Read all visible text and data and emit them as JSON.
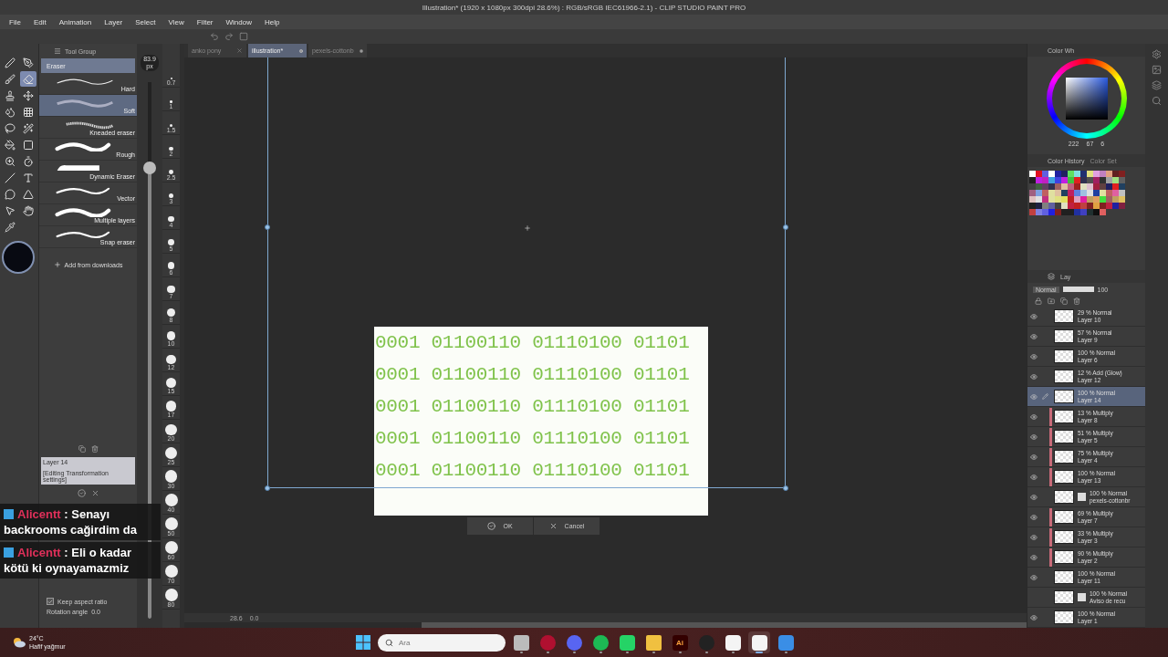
{
  "window": {
    "title": "Illustration* (1920 x 1080px 300dpi 28.6%) : RGB/sRGB IEC61966-2.1) - CLIP STUDIO PAINT PRO"
  },
  "menu": [
    "File",
    "Edit",
    "Animation",
    "Layer",
    "Select",
    "View",
    "Filter",
    "Window",
    "Help"
  ],
  "tools": [
    {
      "kind": "pen",
      "selected": false
    },
    {
      "kind": "pen-tool",
      "selected": false
    },
    {
      "kind": "brush",
      "selected": false
    },
    {
      "kind": "eraser",
      "selected": true
    },
    {
      "kind": "stamp",
      "selected": false
    },
    {
      "kind": "move",
      "selected": false
    },
    {
      "kind": "blend",
      "selected": false
    },
    {
      "kind": "grid",
      "selected": false
    },
    {
      "kind": "lasso",
      "selected": false
    },
    {
      "kind": "wand",
      "selected": false
    },
    {
      "kind": "bucket",
      "selected": false
    },
    {
      "kind": "gradient",
      "selected": false
    },
    {
      "kind": "zoom",
      "selected": false
    },
    {
      "kind": "timer",
      "selected": false
    },
    {
      "kind": "line",
      "selected": false
    },
    {
      "kind": "text",
      "selected": false
    },
    {
      "kind": "balloon",
      "selected": false
    },
    {
      "kind": "triangle",
      "selected": false
    },
    {
      "kind": "pointer",
      "selected": false
    },
    {
      "kind": "hand",
      "selected": false
    },
    {
      "kind": "pipette",
      "selected": false
    }
  ],
  "tool_group": {
    "title": "Tool Group",
    "active": "Eraser"
  },
  "brushes": [
    {
      "name": "Hard",
      "kind": "thin",
      "selected": false
    },
    {
      "name": "Soft",
      "kind": "soft",
      "selected": true
    },
    {
      "name": "Kneaded eraser",
      "kind": "textured",
      "selected": false
    },
    {
      "name": "Rough",
      "kind": "thick",
      "selected": false
    },
    {
      "name": "Dynamic Eraser",
      "kind": "block",
      "selected": false
    },
    {
      "name": "Vector",
      "kind": "medium",
      "selected": false
    },
    {
      "name": "Multiple layers",
      "kind": "thick",
      "selected": false
    },
    {
      "name": "Snap eraser",
      "kind": "medium",
      "selected": false
    }
  ],
  "add_from_downloads": "Add from downloads",
  "tool_property": {
    "layer": "Layer 14",
    "caption": "[Editing Transformation settings]",
    "keep_aspect_ratio": {
      "label": "Keep aspect ratio",
      "checked": true
    },
    "rotation": {
      "label": "Rotation angle",
      "value": "0.0"
    }
  },
  "size": {
    "value": "83.9",
    "unit": "px",
    "level": 0.84
  },
  "brush_sizes": [
    "0.7",
    "1",
    "1.5",
    "2",
    "2.5",
    "3",
    "4",
    "5",
    "6",
    "7",
    "8",
    "10",
    "12",
    "15",
    "17",
    "20",
    "25",
    "30",
    "40",
    "50",
    "60",
    "70",
    "80"
  ],
  "tabs": [
    {
      "label": "anko pony",
      "selected": false,
      "closable": true
    },
    {
      "label": "illustration*",
      "selected": true,
      "closable": false
    },
    {
      "label": "pexels-cottonb",
      "selected": false,
      "closable": false
    }
  ],
  "canvas_lines": [
    "0001 01100110 01110100 01101",
    "0001 01100110 01110100 01101",
    "0001 01100110 01110100 01101",
    "0001 01100110 01110100 01101",
    "0001 01100110 01110100 01101"
  ],
  "transform_buttons": [
    "OK",
    "Cancel"
  ],
  "canvas_status": {
    "zoom": "28.6",
    "angle": "0.0"
  },
  "color_panel": {
    "tab": "Color Wh",
    "h": "222",
    "s": "67",
    "v": "6"
  },
  "color_history": {
    "tab": "Color History",
    "other_tab": "Color Set",
    "swatches": [
      {
        "color": "#ffffff"
      },
      {
        "color": "#e01020"
      },
      {
        "color": "#6060e0"
      },
      {
        "color": "#ffffff"
      },
      {
        "color": "#2020a0"
      },
      {
        "color": "#202060"
      },
      {
        "color": "#60e060"
      },
      {
        "color": "#80e0e0"
      },
      {
        "color": "#203070"
      },
      {
        "color": "#e0e080"
      },
      {
        "color": "#e0a0e0"
      },
      {
        "color": "#c080c0"
      },
      {
        "color": "#e0a080"
      },
      {
        "color": "#602020"
      },
      {
        "color": "#802020"
      },
      {
        "color": "#202020"
      },
      {
        "color": "#c020e0"
      },
      {
        "color": "#c020c0"
      },
      {
        "color": "#40a0e0"
      },
      {
        "color": "#4040e0"
      },
      {
        "color": "#c020e0"
      },
      {
        "color": "#40c040"
      },
      {
        "color": "#e02020"
      },
      {
        "color": "#303050"
      },
      {
        "color": "#505050"
      },
      {
        "color": "#a02060"
      },
      {
        "color": "#303030"
      },
      {
        "color": "#a0a0a0"
      },
      {
        "color": "#a0e080"
      },
      {
        "color": "#606060"
      },
      {
        "color": "#404040"
      },
      {
        "color": "#406040"
      },
      {
        "color": "#604060"
      },
      {
        "color": "#303050"
      },
      {
        "color": "#a06060"
      },
      {
        "color": "#e0c0a0"
      },
      {
        "color": "#c06080"
      },
      {
        "color": "#a02020"
      },
      {
        "color": "#e0e0c0"
      },
      {
        "color": "#e0c0d0"
      },
      {
        "color": "#a02040"
      },
      {
        "color": "#604040"
      },
      {
        "color": "#202060"
      },
      {
        "color": "#e02020"
      },
      {
        "color": "#204060"
      },
      {
        "color": "#a06080"
      },
      {
        "color": "#80a0e0"
      },
      {
        "color": "#c06060"
      },
      {
        "color": "#e0e0a0"
      },
      {
        "color": "#e0c0a0"
      },
      {
        "color": "#204060"
      },
      {
        "color": "#c02060"
      },
      {
        "color": "#6080e0"
      },
      {
        "color": "#a0c0e0"
      },
      {
        "color": "#e0e0e0"
      },
      {
        "color": "#2040a0"
      },
      {
        "color": "#e0e0a0"
      },
      {
        "color": "#c06060"
      },
      {
        "color": "#e060a0"
      },
      {
        "color": "#c0c0c0"
      },
      {
        "color": "#e0c0c0"
      },
      {
        "color": "#e0e0e0"
      },
      {
        "color": "#c03080"
      },
      {
        "color": "#e0e0a0"
      },
      {
        "color": "#e0e080"
      },
      {
        "color": "#e0e060"
      },
      {
        "color": "#c02020"
      },
      {
        "color": "#e0a0c0"
      },
      {
        "color": "#e020a0"
      },
      {
        "color": "#c0a060"
      },
      {
        "color": "#e0a060"
      },
      {
        "color": "#40e040"
      },
      {
        "color": "#a06060"
      },
      {
        "color": "#c0a060"
      },
      {
        "color": "#e0c060"
      },
      {
        "color": "#202020"
      },
      {
        "color": "#202040"
      },
      {
        "color": "#808080"
      },
      {
        "color": "#6060a0"
      },
      {
        "color": "#404040"
      },
      {
        "color": "#e0e0c0"
      },
      {
        "color": "#c02040"
      },
      {
        "color": "#c02020"
      },
      {
        "color": "#c04040"
      },
      {
        "color": "#802020"
      },
      {
        "color": "#e0a040"
      },
      {
        "color": "#802020"
      },
      {
        "color": "#c02040"
      },
      {
        "color": "#2020a0"
      },
      {
        "color": "#802040"
      },
      {
        "color": "#c04040"
      },
      {
        "color": "#8080e0"
      },
      {
        "color": "#6060e0"
      },
      {
        "color": "#2020e0"
      },
      {
        "color": "#802020"
      },
      {
        "color": "#202020"
      },
      {
        "color": "#202020"
      },
      {
        "color": "#2030a0"
      },
      {
        "color": "#4040c0"
      },
      {
        "color": "#203030"
      },
      {
        "color": "#101010"
      },
      {
        "color": "#e06060"
      }
    ]
  },
  "layer_panel": {
    "tab": "Lay",
    "blend": "Normal",
    "opacity": "100",
    "level": 1
  },
  "layers": [
    {
      "blend": "29 % Normal",
      "name": "Layer 10",
      "visible": true,
      "selected": false,
      "clipped": false,
      "kind": "raster"
    },
    {
      "blend": "57 % Normal",
      "name": "Layer 9",
      "visible": true,
      "selected": false,
      "clipped": false,
      "kind": "raster"
    },
    {
      "blend": "100 % Normal",
      "name": "Layer 6",
      "visible": true,
      "selected": false,
      "clipped": false,
      "kind": "raster"
    },
    {
      "blend": "12 % Add (Glow)",
      "name": "Layer 12",
      "visible": true,
      "selected": false,
      "clipped": false,
      "kind": "raster"
    },
    {
      "blend": "100 % Normal",
      "name": "Layer 14",
      "visible": true,
      "selected": true,
      "clipped": false,
      "kind": "raster"
    },
    {
      "blend": "13 % Multiply",
      "name": "Layer 8",
      "visible": true,
      "selected": false,
      "clipped": true,
      "kind": "raster"
    },
    {
      "blend": "51 % Multiply",
      "name": "Layer 5",
      "visible": true,
      "selected": false,
      "clipped": true,
      "kind": "raster"
    },
    {
      "blend": "75 % Multiply",
      "name": "Layer 4",
      "visible": true,
      "selected": false,
      "clipped": true,
      "kind": "raster"
    },
    {
      "blend": "100 % Normal",
      "name": "Layer 13",
      "visible": true,
      "selected": false,
      "clipped": true,
      "kind": "raster"
    },
    {
      "blend": "100 % Normal",
      "name": "pexels-cottonbr",
      "visible": true,
      "selected": false,
      "clipped": false,
      "kind": "image"
    },
    {
      "blend": "69 % Multiply",
      "name": "Layer 7",
      "visible": true,
      "selected": false,
      "clipped": true,
      "kind": "raster"
    },
    {
      "blend": "33 % Multiply",
      "name": "Layer 3",
      "visible": true,
      "selected": false,
      "clipped": true,
      "kind": "raster"
    },
    {
      "blend": "90 % Multiply",
      "name": "Layer 2",
      "visible": true,
      "selected": false,
      "clipped": true,
      "kind": "raster"
    },
    {
      "blend": "100 % Normal",
      "name": "Layer 11",
      "visible": true,
      "selected": false,
      "clipped": false,
      "kind": "raster"
    },
    {
      "blend": "100 % Normal",
      "name": "Aviso de recu",
      "visible": false,
      "selected": false,
      "clipped": false,
      "kind": "image"
    },
    {
      "blend": "100 % Normal",
      "name": "Layer 1",
      "visible": true,
      "selected": false,
      "clipped": false,
      "kind": "raster"
    }
  ],
  "chat": [
    {
      "user": "Alicentt",
      "text": ": Senayı backrooms cağirdim da"
    },
    {
      "user": "Alicentt",
      "text": ": Eli o kadar kötü ki oynayamazmiz"
    }
  ],
  "taskbar": {
    "weather": {
      "temp": "24°C",
      "desc": "Hafif yağmur"
    },
    "search": {
      "placeholder": "Ara"
    },
    "apps": [
      {
        "kind": "task-view",
        "selected": false
      },
      {
        "kind": "opera",
        "selected": false
      },
      {
        "kind": "discord",
        "selected": false
      },
      {
        "kind": "spotify",
        "selected": false
      },
      {
        "kind": "whatsapp",
        "selected": false
      },
      {
        "kind": "folder",
        "selected": false
      },
      {
        "kind": "illustrator",
        "label": "Ai",
        "selected": false
      },
      {
        "kind": "obs",
        "selected": false
      },
      {
        "kind": "clip",
        "selected": false
      },
      {
        "kind": "clip",
        "selected": true
      },
      {
        "kind": "photos",
        "selected": false
      }
    ]
  }
}
